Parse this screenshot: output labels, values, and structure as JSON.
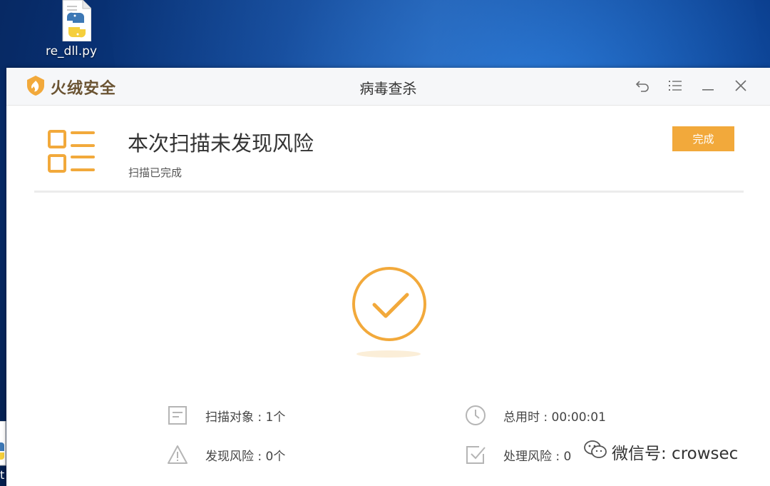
{
  "desktop": {
    "file_icon": {
      "name": "python-file-icon",
      "label": "re_dll.py"
    },
    "edge_label": "t"
  },
  "window": {
    "brand": "火绒安全",
    "title": "病毒查杀",
    "controls": [
      "back-icon",
      "menu-icon",
      "minimize-icon",
      "close-icon"
    ]
  },
  "result": {
    "headline": "本次扫描未发现风险",
    "subline": "扫描已完成",
    "done_label": "完成"
  },
  "stats": {
    "scan_objects": "扫描对象 : 1个",
    "risks_found": "发现风险 : 0个",
    "total_time": "总用时 : 00:00:01",
    "risks_handled": "处理风险 : 0"
  },
  "watermark": "微信号: crowsec",
  "colors": {
    "accent": "#f2a93b",
    "brand_text": "#6a5332",
    "icon_gray": "#b5b5b5"
  }
}
